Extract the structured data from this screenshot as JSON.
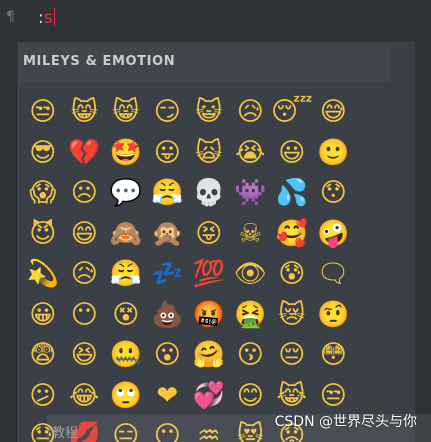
{
  "editor": {
    "paragraph_icon": "¶",
    "typed_prefix": ":",
    "typed_letter": "s"
  },
  "picker": {
    "category_title": "MILEYS & EMOTION",
    "emojis": [
      "😒",
      "😸",
      "😸",
      "😏",
      "😺",
      "😥",
      "😴",
      "😅",
      "😎",
      "💔",
      "🤩",
      "😛",
      "🙀",
      "😭",
      "😃",
      "🙂",
      "😱",
      "☹",
      "💬",
      "😤",
      "💀",
      "👾",
      "💦",
      "😯",
      "😈",
      "😄",
      "🙈",
      "🙊",
      "😝",
      "☠",
      "🥰",
      "🤪",
      "💫",
      "😥",
      "😤",
      "💤",
      "💯",
      "👁",
      "😰",
      "🗨",
      "😀",
      "😶",
      "😵",
      "💩",
      "🤬",
      "🤮",
      "😿",
      "🤨",
      "😨",
      "😆",
      "🤐",
      "😮",
      "🤗",
      "😗",
      "😔",
      "😳",
      "😕",
      "😂",
      "🙄",
      "❤",
      "💞",
      "😊",
      "😹",
      "😒",
      "😓",
      "💋",
      "😑",
      "😶",
      "♒",
      "😻",
      "😟"
    ]
  },
  "below": {
    "text": "教程"
  },
  "watermark": {
    "text": "CSDN @世界尽头与你"
  }
}
